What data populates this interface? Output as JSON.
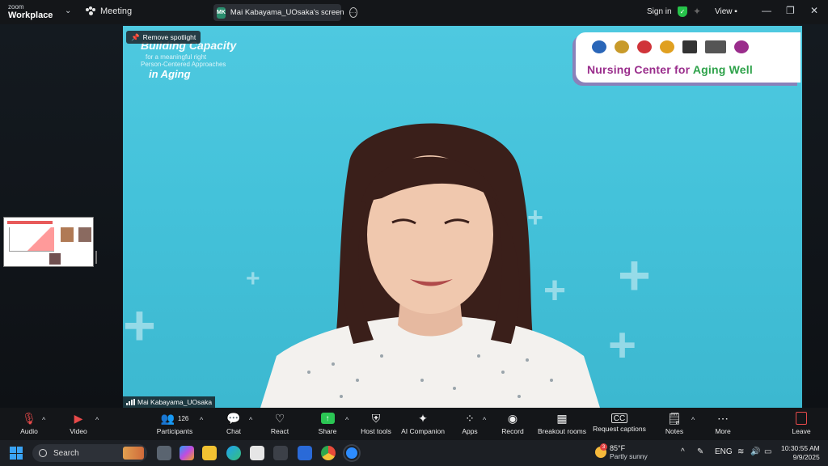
{
  "titlebar": {
    "brand_small": "zoom",
    "brand_large": "Workplace",
    "meeting_label": "Meeting",
    "share_initials": "MK",
    "share_label": "Mai Kabayama_UOsaka's screen",
    "signin_label": "Sign in",
    "view_label": "View"
  },
  "slide": {
    "line1": "Building Capacity",
    "line2": "for a meaningful right",
    "line3": "Person-Centered Approaches",
    "line4": "in Aging",
    "center_name_a": "Nursing Center for ",
    "center_name_b": "Aging Well"
  },
  "spotlight_label": "Remove spotlight",
  "participant_name": "Mai Kabayama_UOsaka",
  "toolbar": {
    "audio": "Audio",
    "video": "Video",
    "participants": "Participants",
    "participants_count": "126",
    "chat": "Chat",
    "react": "React",
    "share": "Share",
    "host_tools": "Host tools",
    "ai_companion": "AI Companion",
    "apps": "Apps",
    "record": "Record",
    "breakout": "Breakout rooms",
    "captions": "Request captions",
    "notes": "Notes",
    "more": "More",
    "leave": "Leave"
  },
  "taskbar": {
    "search_label": "Search",
    "weather_temp": "85°F",
    "weather_desc": "Partly sunny",
    "weather_badge": "3",
    "lang": "ENG",
    "time": "10:30:55 AM",
    "date": "9/9/2025"
  },
  "colors": {
    "accent_green": "#2bc654",
    "slide_bg": "#4ec9e0",
    "brand_purple": "#9a2d8c"
  }
}
